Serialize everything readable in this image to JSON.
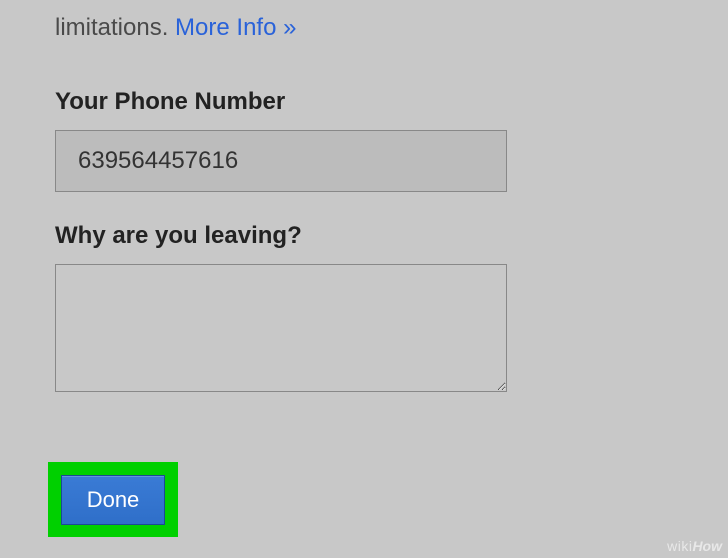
{
  "intro": {
    "text_prefix": "limitations. ",
    "more_info_label": "More Info »"
  },
  "phone": {
    "label": "Your Phone Number",
    "value": "639564457616"
  },
  "reason": {
    "label": "Why are you leaving?",
    "value": ""
  },
  "done": {
    "label": "Done"
  },
  "watermark": {
    "wiki": "wiki",
    "how": "How"
  }
}
